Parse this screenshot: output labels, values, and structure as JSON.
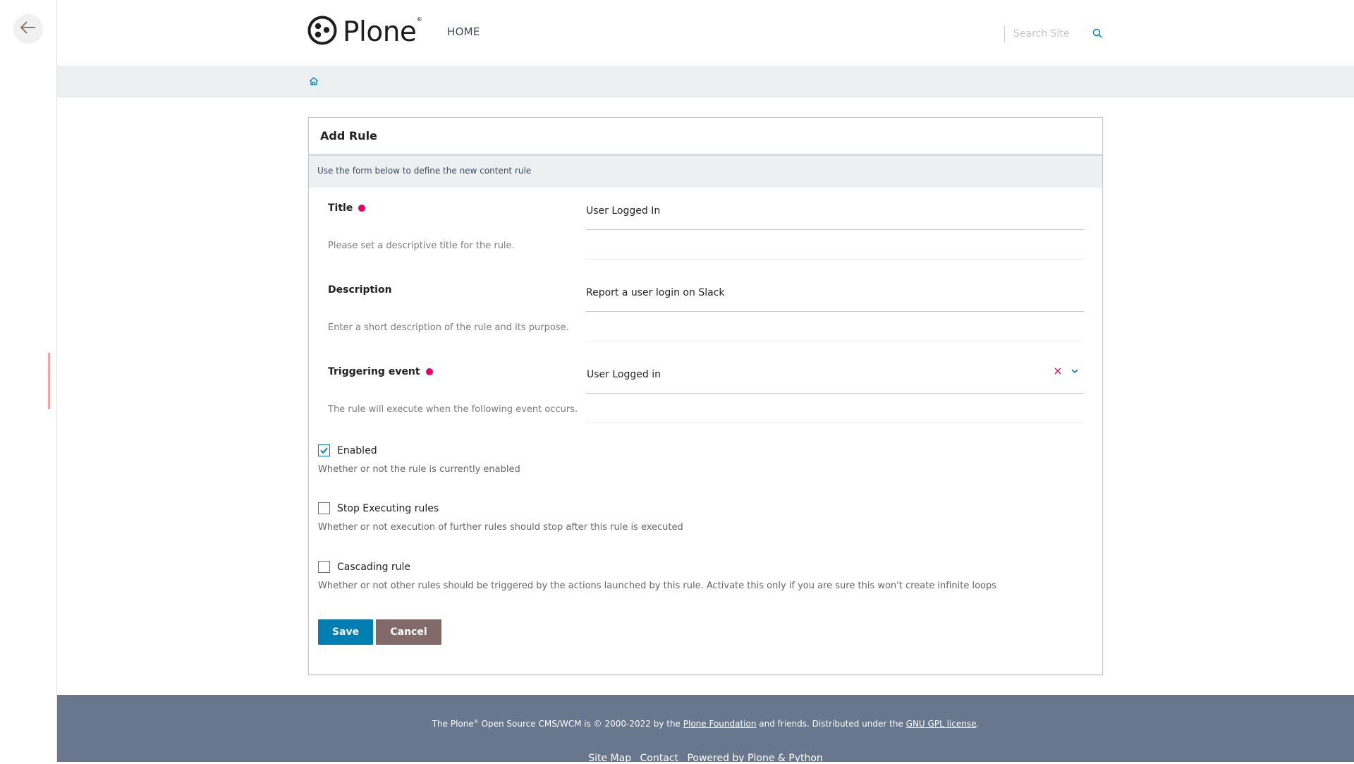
{
  "brand": {
    "name": "Plone",
    "trademark": "®"
  },
  "nav": {
    "home": "HOME"
  },
  "search": {
    "placeholder": "Search Site"
  },
  "form": {
    "title": "Add Rule",
    "info": "Use the form below to define the new content rule",
    "fields": {
      "title": {
        "label": "Title",
        "value": "User Logged In",
        "help": "Please set a descriptive title for the rule."
      },
      "description": {
        "label": "Description",
        "value": "Report a user login on Slack",
        "help": "Enter a short description of the rule and its purpose."
      },
      "event": {
        "label": "Triggering event",
        "value": "User Logged in",
        "help": "The rule will execute when the following event occurs."
      }
    },
    "checkboxes": {
      "enabled": {
        "label": "Enabled",
        "checked": true,
        "help": "Whether or not the rule is currently enabled"
      },
      "stop": {
        "label": "Stop Executing rules",
        "checked": false,
        "help": "Whether or not execution of further rules should stop after this rule is executed"
      },
      "cascading": {
        "label": "Cascading rule",
        "checked": false,
        "help": "Whether or not other rules should be triggered by the actions launched by this rule. Activate this only if you are sure this won't create infinite loops"
      }
    },
    "buttons": {
      "save": "Save",
      "cancel": "Cancel"
    }
  },
  "footer": {
    "prefix": "The Plone",
    "mark": "®",
    "middle": " Open Source CMS/WCM is © 2000-2022 by the ",
    "foundation": "Plone Foundation",
    "suffix": " and friends. Distributed under the ",
    "license": "GNU GPL license",
    "end": ".",
    "links": {
      "sitemap": "Site Map",
      "contact": "Contact",
      "powered": "Powered by Plone & Python"
    }
  },
  "colors": {
    "accent": "#007eb1",
    "required": "#e40166",
    "cancel": "#826a6a",
    "footer": "#68778d"
  }
}
